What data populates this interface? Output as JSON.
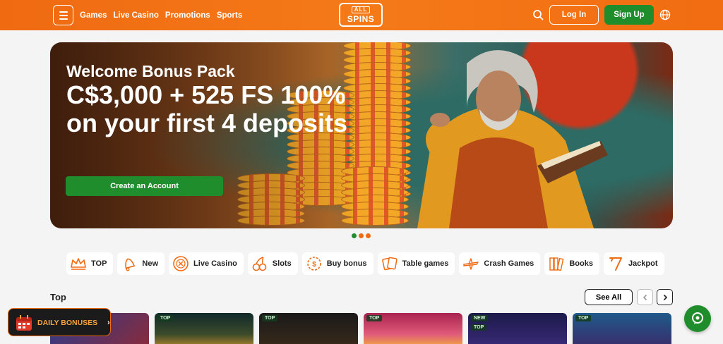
{
  "header": {
    "nav": [
      "Games",
      "Live Casino",
      "Promotions",
      "Sports"
    ],
    "logo_top": "ALL",
    "logo_bottom": "SPINS",
    "login_label": "Log In",
    "signup_label": "Sign Up",
    "icons": {
      "menu": "hamburger-icon",
      "search": "search-icon",
      "language": "globe-icon"
    }
  },
  "banner": {
    "kicker": "Welcome Bonus Pack",
    "headline": "C$3,000 + 525 FS 100% on your first 4 deposits",
    "cta_label": "Create an Account",
    "dots": [
      {
        "color": "#1f8d2b"
      },
      {
        "color": "#f06a12"
      },
      {
        "color": "#f06a12"
      }
    ]
  },
  "categories": [
    {
      "label": "TOP",
      "icon": "crown-icon"
    },
    {
      "label": "New",
      "icon": "bell-icon"
    },
    {
      "label": "Live Casino",
      "icon": "live-chip-icon"
    },
    {
      "label": "Slots",
      "icon": "cherries-icon"
    },
    {
      "label": "Buy bonus",
      "icon": "bonus-gear-icon"
    },
    {
      "label": "Table games",
      "icon": "cards-icon"
    },
    {
      "label": "Crash Games",
      "icon": "plane-icon"
    },
    {
      "label": "Books",
      "icon": "books-icon"
    },
    {
      "label": "Jackpot",
      "icon": "seven-icon"
    }
  ],
  "top_section": {
    "title": "Top",
    "see_all_label": "See All",
    "prev_icon": "chevron-left-icon",
    "next_icon": "chevron-right-icon",
    "tiles": [
      {
        "tags": []
      },
      {
        "tags": [
          "TOP"
        ]
      },
      {
        "tags": [
          "TOP"
        ]
      },
      {
        "tags": [
          "TOP"
        ]
      },
      {
        "tags": [
          "NEW",
          "TOP"
        ]
      },
      {
        "tags": [
          "TOP"
        ]
      }
    ]
  },
  "floating": {
    "daily_bonuses_label": "DAILY BONUSES",
    "daily_icon": "calendar-icon",
    "chat_icon": "chat-icon"
  },
  "colors": {
    "brand_orange": "#f06a12",
    "brand_green": "#1f8d2b",
    "background": "#f4f4f5"
  }
}
